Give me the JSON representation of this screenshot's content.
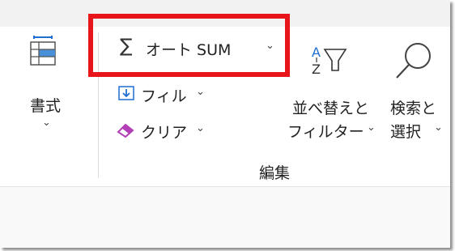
{
  "ribbon": {
    "format": {
      "label": "書式",
      "chevron": "⌄",
      "icon": "format-table-icon"
    },
    "autosum": {
      "symbol": "∑",
      "label": "オート SUM",
      "chevron": "⌄",
      "icon": "sigma-icon"
    },
    "fill": {
      "label": "フィル",
      "chevron": "⌄",
      "icon": "fill-down-icon"
    },
    "clear": {
      "label": "クリア",
      "chevron": "⌄",
      "icon": "eraser-icon"
    },
    "sort_filter": {
      "label_line1": "並べ替えと",
      "label_line2": "フィルター",
      "chevron": "⌄",
      "icon": "sort-filter-icon"
    },
    "find_select": {
      "label_line1": "検索と",
      "label_line2": "選択",
      "chevron": "⌄",
      "icon": "magnifier-icon"
    },
    "group_label": "編集"
  },
  "colors": {
    "highlight": "#e8161b",
    "accent_blue": "#1f6fd0",
    "eraser_purple": "#b23fb5"
  }
}
